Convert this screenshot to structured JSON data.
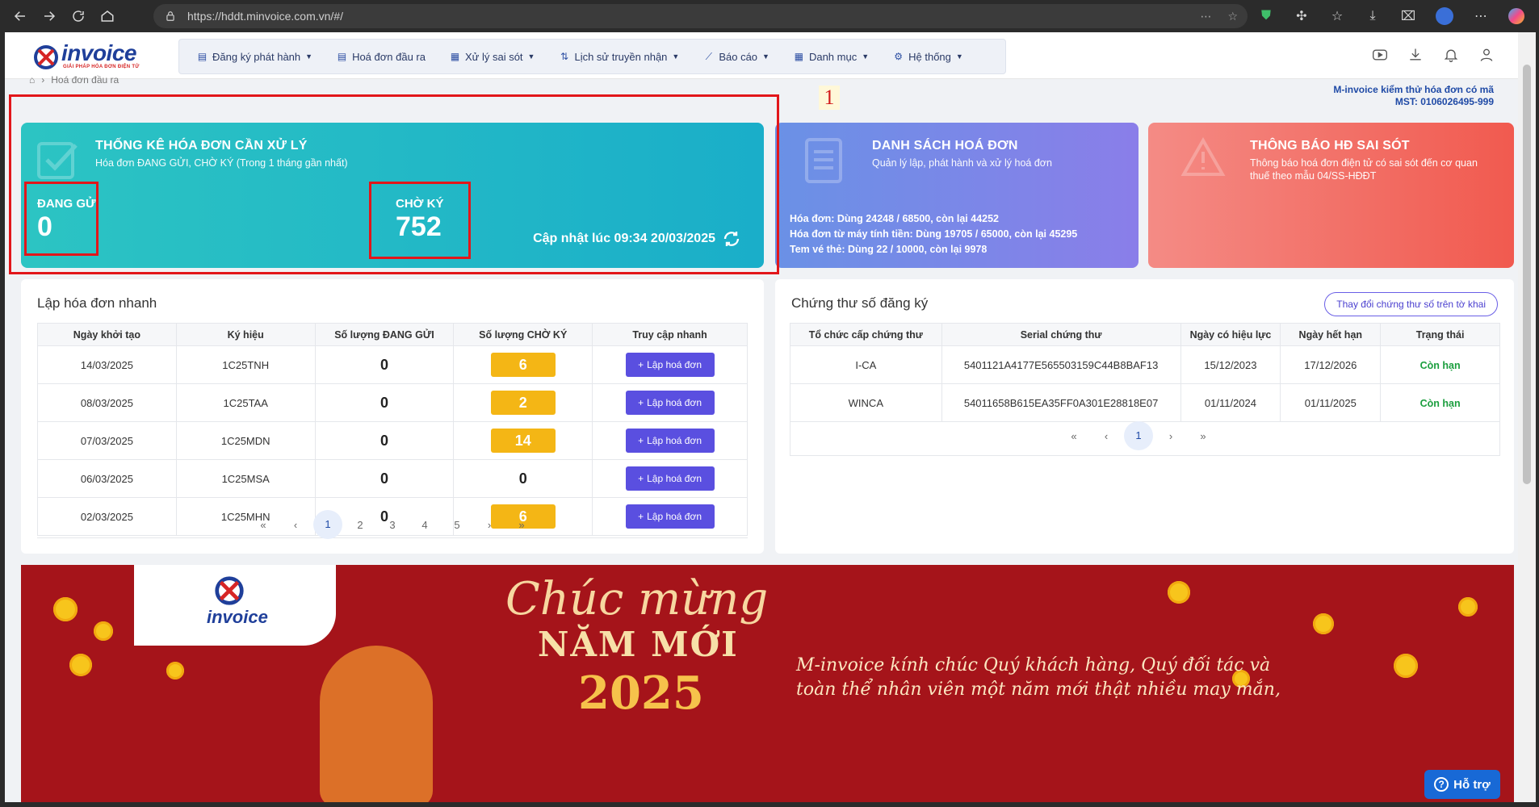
{
  "browser": {
    "url": "https://hddt.minvoice.com.vn/#/"
  },
  "header": {
    "logo_text": "invoice",
    "logo_tagline": "GIẢI PHÁP HÓA ĐƠN ĐIỆN TỬ",
    "menu": [
      {
        "label": "Đăng ký phát hành",
        "icon": "file-icon",
        "has_dropdown": true
      },
      {
        "label": "Hoá đơn đầu ra",
        "icon": "file-icon",
        "has_dropdown": false
      },
      {
        "label": "Xử lý sai sót",
        "icon": "file-edit-icon",
        "has_dropdown": true
      },
      {
        "label": "Lịch sử truyền nhận",
        "icon": "arrows-icon",
        "has_dropdown": true
      },
      {
        "label": "Báo cáo",
        "icon": "chart-icon",
        "has_dropdown": true
      },
      {
        "label": "Danh mục",
        "icon": "grid-icon",
        "has_dropdown": true
      },
      {
        "label": "Hệ thống",
        "icon": "gear-icon",
        "has_dropdown": true
      }
    ]
  },
  "breadcrumb": {
    "current": "Hoá đơn đầu ra"
  },
  "company": {
    "name": "M-invoice kiểm thử hóa đơn có mã",
    "mst": "MST: 0106026495-999"
  },
  "annotation": "1",
  "stats_card": {
    "title": "THỐNG KÊ HÓA ĐƠN CẦN XỬ LÝ",
    "subtitle": "Hóa đơn ĐANG GỬI, CHỜ KÝ (Trong 1 tháng gần nhất)",
    "sending_label": "ĐANG GỬI",
    "sending_value": "0",
    "pending_label": "CHỜ KÝ",
    "pending_value": "752",
    "updated": "Cập nhật lúc 09:34 20/03/2025"
  },
  "list_card": {
    "title": "DANH SÁCH HOÁ ĐƠN",
    "subtitle": "Quản lý lập, phát hành và xử lý hoá đơn",
    "line1": "Hóa đơn: Dùng 24248 / 68500, còn lại 44252",
    "line2": "Hóa đơn từ máy tính tiền: Dùng 19705 / 65000, còn lại 45295",
    "line3": "Tem vé thẻ: Dùng 22 / 10000, còn lại 9978"
  },
  "error_card": {
    "title": "THÔNG BÁO HĐ SAI SÓT",
    "subtitle_1": "Thông báo hoá đơn điện tử có sai sót đến cơ quan",
    "subtitle_2": "thuế theo mẫu 04/SS-HĐĐT"
  },
  "quick_panel": {
    "title": "Lập hóa đơn nhanh",
    "columns": [
      "Ngày khởi tạo",
      "Ký hiệu",
      "Số lượng ĐANG GỬI",
      "Số lượng CHỜ KÝ",
      "Truy cập nhanh"
    ],
    "button_label": "Lập hoá đơn",
    "rows": [
      {
        "date": "14/03/2025",
        "symbol": "1C25TNH",
        "sending": "0",
        "pending": "6"
      },
      {
        "date": "08/03/2025",
        "symbol": "1C25TAA",
        "sending": "0",
        "pending": "2"
      },
      {
        "date": "07/03/2025",
        "symbol": "1C25MDN",
        "sending": "0",
        "pending": "14"
      },
      {
        "date": "06/03/2025",
        "symbol": "1C25MSA",
        "sending": "0",
        "pending": "0"
      },
      {
        "date": "02/03/2025",
        "symbol": "1C25MHN",
        "sending": "0",
        "pending": "6"
      }
    ],
    "pages": [
      "1",
      "2",
      "3",
      "4",
      "5"
    ],
    "current_page": "1"
  },
  "cert_panel": {
    "title": "Chứng thư số đăng ký",
    "change_button": "Thay đổi chứng thư số trên tờ khai",
    "columns": [
      "Tổ chức cấp chứng thư",
      "Serial chứng thư",
      "Ngày có hiệu lực",
      "Ngày hết hạn",
      "Trạng thái"
    ],
    "rows": [
      {
        "issuer": "I-CA",
        "serial": "5401121A4177E565503159C44B8BAF13",
        "from": "15/12/2023",
        "to": "17/12/2026",
        "status": "Còn hạn"
      },
      {
        "issuer": "WINCA",
        "serial": "54011658B615EA35FF0A301E28818E07",
        "from": "01/11/2024",
        "to": "01/11/2025",
        "status": "Còn hạn"
      }
    ],
    "pages": [
      "1"
    ],
    "current_page": "1"
  },
  "banner": {
    "logo_text": "invoice",
    "script": "Chúc mừng",
    "headline": "NĂM MỚI",
    "year": "2025",
    "wish_1": "M-invoice kính chúc Quý khách hàng, Quý đối tác và",
    "wish_2": "toàn thể nhân viên một năm mới thật nhiều may mắn,"
  },
  "help_button": "Hỗ trợ",
  "colors": {
    "teal": "#1fb8c6",
    "blue": "#7a88e8",
    "red": "#f2675e",
    "accent": "#5a4fe0",
    "warning": "#f4b615",
    "annotation_red": "#e2161a"
  }
}
